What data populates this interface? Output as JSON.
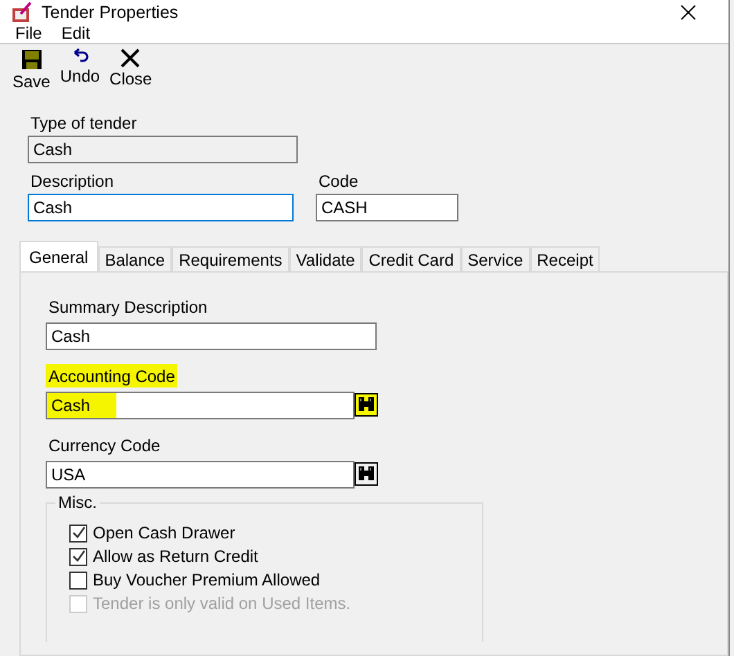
{
  "window": {
    "title": "Tender Properties"
  },
  "menu": [
    "File",
    "Edit"
  ],
  "toolbar": [
    {
      "kind": "save",
      "label": "Save"
    },
    {
      "kind": "undo",
      "label": "Undo"
    },
    {
      "kind": "close",
      "label": "Close"
    }
  ],
  "type_of_tender": {
    "label": "Type of tender",
    "value": "Cash",
    "disabled": true
  },
  "description": {
    "label": "Description",
    "value": "Cash",
    "focused": true
  },
  "code": {
    "label": "Code",
    "value": "CASH"
  },
  "tabs": [
    {
      "label": "General",
      "selected": true
    },
    {
      "label": "Balance",
      "selected": false
    },
    {
      "label": "Requirements",
      "selected": false
    },
    {
      "label": "Validate",
      "selected": false
    },
    {
      "label": "Credit Card",
      "selected": false
    },
    {
      "label": "Service",
      "selected": false
    },
    {
      "label": "Receipt",
      "selected": false
    }
  ],
  "fields": [
    {
      "label": "Summary Description",
      "value": "Cash",
      "lookup": false,
      "highlighted": false
    },
    {
      "label": "Accounting Code",
      "value": "Cash",
      "lookup": true,
      "highlighted": true
    },
    {
      "label": "Currency Code",
      "value": "USA",
      "lookup": true,
      "highlighted": false
    }
  ],
  "misc": {
    "title": "Misc.",
    "options": [
      {
        "label": "Open Cash Drawer",
        "checked": true,
        "disabled": false
      },
      {
        "label": "Allow as Return Credit",
        "checked": true,
        "disabled": false
      },
      {
        "label": "Buy Voucher Premium Allowed",
        "checked": false,
        "disabled": false
      },
      {
        "label": "Tender is only valid on Used Items.",
        "checked": false,
        "disabled": true
      }
    ]
  }
}
